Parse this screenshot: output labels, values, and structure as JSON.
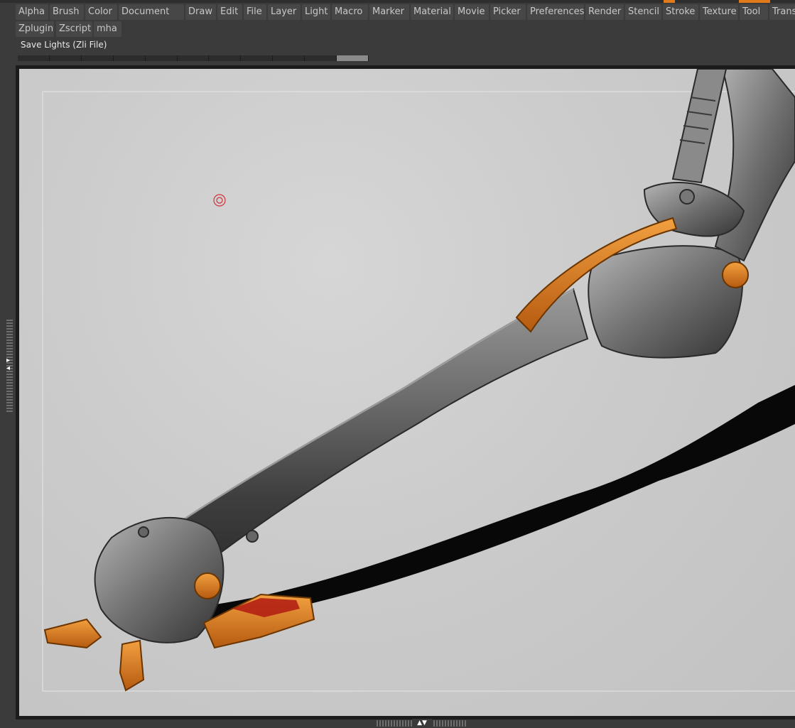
{
  "menubar": {
    "row1": [
      "Alpha",
      "Brush",
      "Color",
      "Document",
      "Draw",
      "Edit",
      "File",
      "Layer",
      "Light",
      "Macro",
      "Marker",
      "Material",
      "Movie",
      "Picker",
      "Preferences",
      "Render",
      "Stencil",
      "Stroke",
      "Texture",
      "Tool",
      "Transform"
    ],
    "row2": [
      "Zplugin",
      "Zscript",
      "mha"
    ]
  },
  "status": {
    "label": "Save Lights (Zli File)"
  },
  "segment_bar": {
    "segments": 11,
    "active_index": 10
  },
  "icons": {
    "cursor": "target-cursor-icon",
    "left_toggle": "collapse-arrow-icon",
    "bottom_toggle": "expand-arrows-icon"
  },
  "colors": {
    "accent_orange": "#e07a1a",
    "canvas_bg": "#cbcbcb",
    "menu_button": "#474747",
    "menu_text": "#c8c8c8"
  }
}
